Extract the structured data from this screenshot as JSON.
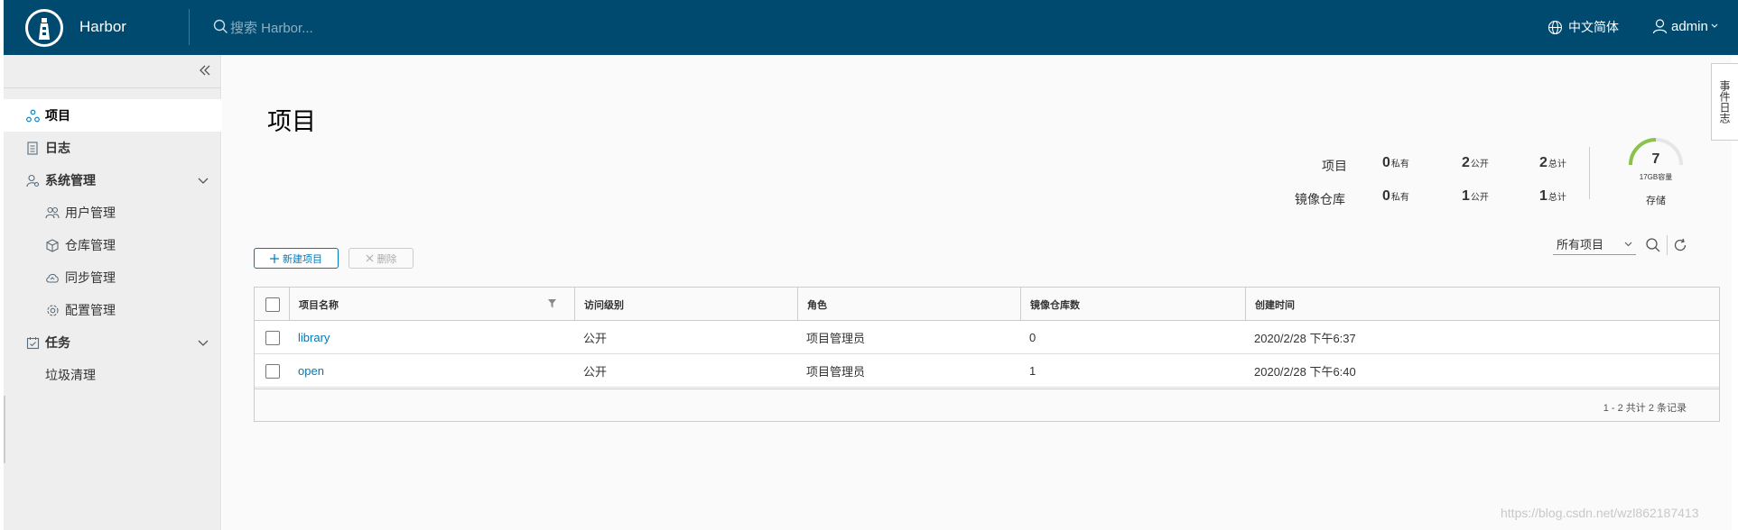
{
  "header": {
    "app_name": "Harbor",
    "search_placeholder": "搜索 Harbor...",
    "language": "中文简体",
    "user": "admin"
  },
  "sidebar": {
    "items": [
      {
        "label": "项目",
        "icon": "projects-icon"
      },
      {
        "label": "日志",
        "icon": "logs-icon"
      },
      {
        "label": "系统管理",
        "icon": "admin-icon"
      },
      {
        "label": "用户管理",
        "icon": "users-icon"
      },
      {
        "label": "仓库管理",
        "icon": "registry-icon"
      },
      {
        "label": "同步管理",
        "icon": "replication-icon"
      },
      {
        "label": "配置管理",
        "icon": "config-icon"
      },
      {
        "label": "任务",
        "icon": "tasks-icon"
      },
      {
        "label": "垃圾清理"
      }
    ]
  },
  "main": {
    "title": "项目",
    "stats": {
      "projects_label": "项目",
      "repos_label": "镜像仓库",
      "private_suffix": "私有",
      "public_suffix": "公开",
      "total_suffix": "总计",
      "projects": {
        "private": "0",
        "public": "2",
        "total": "2"
      },
      "repos": {
        "private": "0",
        "public": "1",
        "total": "1"
      },
      "storage_value": "7",
      "storage_capacity": "17GB容量",
      "storage_label": "存储"
    },
    "new_button": "新建项目",
    "delete_button": "删除",
    "filter_value": "所有项目",
    "table": {
      "headers": [
        "项目名称",
        "访问级别",
        "角色",
        "镜像仓库数",
        "创建时间"
      ],
      "rows": [
        {
          "name": "library",
          "access": "公开",
          "role": "项目管理员",
          "repos": "0",
          "created": "2020/2/28 下午6:37"
        },
        {
          "name": "open",
          "access": "公开",
          "role": "项目管理员",
          "repos": "1",
          "created": "2020/2/28 下午6:40"
        }
      ],
      "footer": "1 - 2 共计 2 条记录"
    }
  },
  "side_tab": "事件日志",
  "watermark": "https://blog.csdn.net/wzl862187413",
  "colors": {
    "header_bg": "#004a70",
    "link": "#0079b8",
    "gauge": "#8bc34a"
  }
}
